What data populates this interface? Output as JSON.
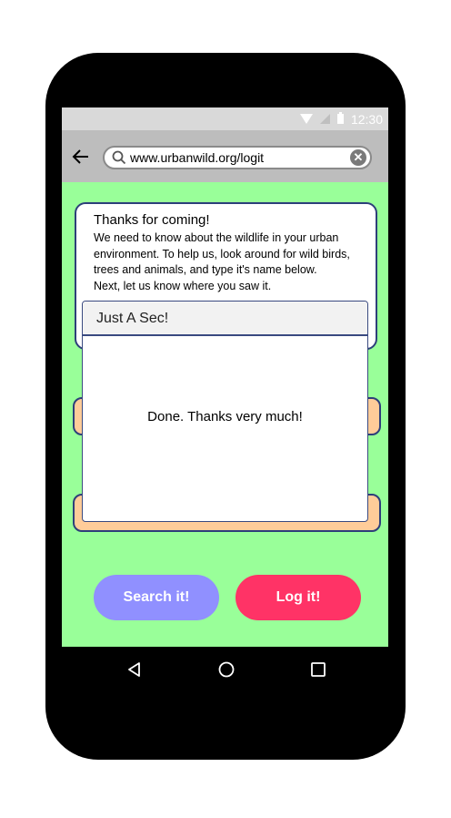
{
  "status_bar": {
    "time": "12:30"
  },
  "browser": {
    "url": "www.urbanwild.org/logit"
  },
  "info_card": {
    "title": "Thanks for coming!",
    "lines": [
      "We need to know about the wildlife in your urban",
      "environment. To help us, look around for wild birds,",
      "trees and animals, and type it's name below.",
      "Next, let us know where you saw it."
    ]
  },
  "buttons": {
    "search": "Search it!",
    "log": "Log it!"
  },
  "dialog": {
    "title": "Just A Sec!",
    "message": "Done. Thanks very much!"
  },
  "colors": {
    "screen_bg": "#99ff99",
    "field_bg": "#ffcc99",
    "search_button": "#9090ff",
    "log_button": "#ff3366"
  },
  "icons": [
    "wifi-icon",
    "signal-icon",
    "battery-icon",
    "back-arrow-icon",
    "search-icon",
    "clear-icon",
    "nav-back-icon",
    "nav-home-icon",
    "nav-recents-icon"
  ]
}
